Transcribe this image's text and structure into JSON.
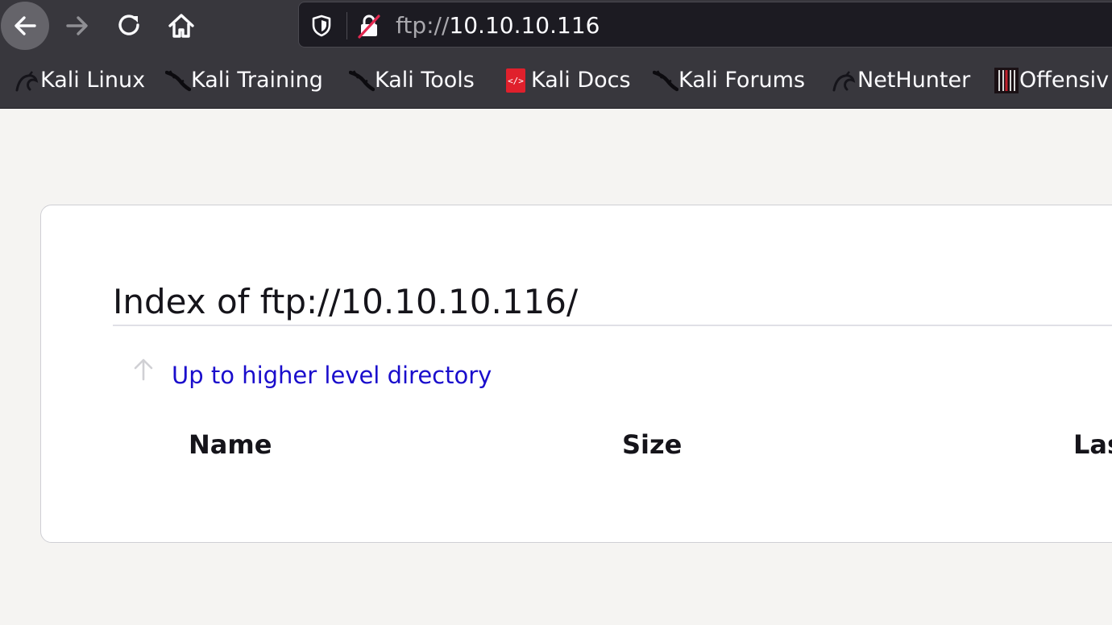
{
  "toolbar": {
    "back_icon": "arrow-left-icon",
    "forward_icon": "arrow-right-icon",
    "reload_icon": "reload-icon",
    "home_icon": "home-icon"
  },
  "urlbar": {
    "scheme": "ftp://",
    "host": "10.10.10.116",
    "shield_icon": "tracking-protection-shield-icon",
    "lock_icon": "insecure-lock-icon"
  },
  "bookmarks": [
    {
      "label": "Kali Linux",
      "icon": "kali-dragon-icon"
    },
    {
      "label": "Kali Training",
      "icon": "kali-dragon-icon"
    },
    {
      "label": "Kali Tools",
      "icon": "kali-dragon-icon"
    },
    {
      "label": "Kali Docs",
      "icon": "docs-icon"
    },
    {
      "label": "Kali Forums",
      "icon": "kali-dragon-icon"
    },
    {
      "label": "NetHunter",
      "icon": "kali-dragon-icon"
    },
    {
      "label": "Offensiv",
      "icon": "offsec-icon"
    }
  ],
  "page": {
    "title": "Index of ftp://10.10.10.116/",
    "up_link": "Up to higher level directory",
    "columns": [
      "Name",
      "Size",
      "Las"
    ]
  },
  "colors": {
    "toolbar_bg": "#38373d",
    "urlbar_bg": "#1c1b22",
    "link": "#1a0dcc",
    "page_bg": "#f5f4f2"
  }
}
